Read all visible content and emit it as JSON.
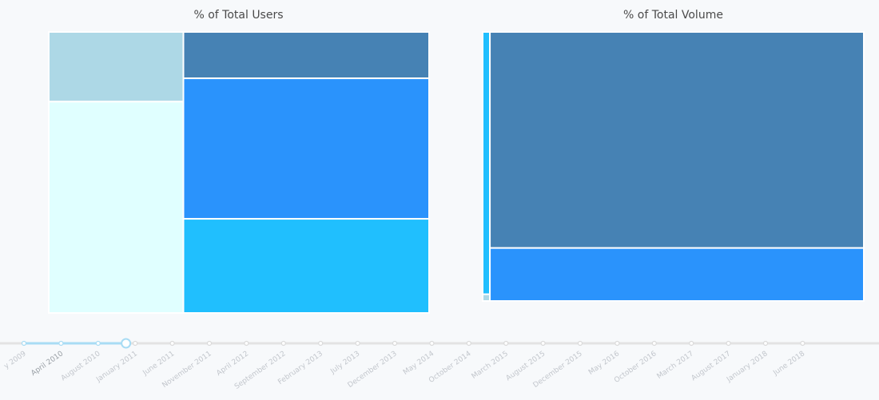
{
  "chart_data": [
    {
      "type": "treemap",
      "title": "% of Total Users",
      "colors": [
        "#add8e6",
        "#e0ffff",
        "#4682b4",
        "#2a93fc",
        "#20bffe"
      ],
      "columns": [
        {
          "share": 0.354,
          "segments": [
            0.248,
            0.752
          ]
        },
        {
          "share": 0.646,
          "segments": [
            0.165,
            0.5,
            0.335
          ]
        }
      ]
    },
    {
      "type": "treemap",
      "title": "% of Total Volume",
      "colors": [
        "#20bffe",
        "#add8e6",
        "#4682b4",
        "#2a93fc"
      ],
      "columns": [
        {
          "share": 0.019,
          "segments": [
            0.975,
            0.025
          ]
        },
        {
          "share": 0.981,
          "segments": [
            0.803,
            0.197
          ]
        }
      ]
    }
  ],
  "timeline": {
    "labels": [
      "y 2009",
      "April 2010",
      "August 2010",
      "January 2011",
      "June 2011",
      "November 2011",
      "April 2012",
      "September 2012",
      "February 2013",
      "July 2013",
      "December 2013",
      "May 2014",
      "October 2014",
      "March 2015",
      "August 2015",
      "December 2015",
      "May 2016",
      "October 2016",
      "March 2017",
      "August 2017",
      "January 2018",
      "June 2018"
    ],
    "current_label": "April 2010",
    "progress": 0.131,
    "colors": {
      "track": "#e3e3e3",
      "fill": "#a8dcf4",
      "label": "#c2c6cc"
    }
  }
}
